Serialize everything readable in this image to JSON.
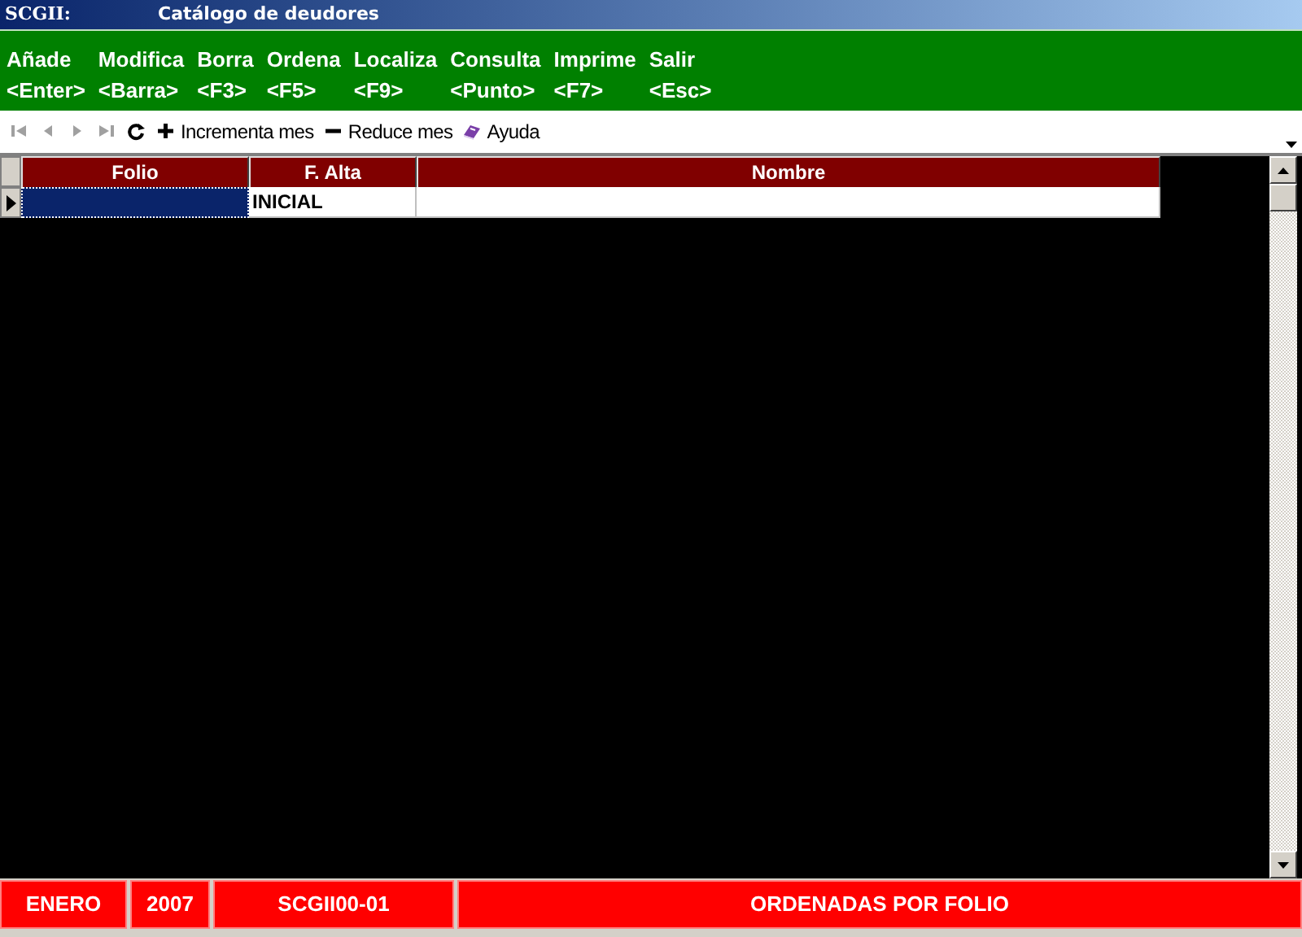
{
  "title_bar": {
    "app": "SCGII:",
    "title": "Catálogo de deudores"
  },
  "menu": [
    {
      "label": "Añade",
      "key": "<Enter>"
    },
    {
      "label": "Modifica",
      "key": "<Barra>"
    },
    {
      "label": "Borra",
      "key": "<F3>"
    },
    {
      "label": "Ordena",
      "key": "<F5>"
    },
    {
      "label": "Localiza",
      "key": "<F9>"
    },
    {
      "label": "Consulta",
      "key": "<Punto>"
    },
    {
      "label": "Imprime",
      "key": "<F7>"
    },
    {
      "label": "Salir",
      "key": "<Esc>"
    }
  ],
  "toolbar": [
    {
      "kind": "first",
      "disabled": true
    },
    {
      "kind": "prev",
      "disabled": true
    },
    {
      "kind": "next",
      "disabled": true
    },
    {
      "kind": "last",
      "disabled": true
    },
    {
      "kind": "refresh"
    },
    {
      "kind": "add",
      "label": "Incrementa mes"
    },
    {
      "kind": "remove",
      "label": "Reduce mes"
    },
    {
      "kind": "help",
      "label": "Ayuda"
    }
  ],
  "table": {
    "columns": [
      {
        "label": "Folio"
      },
      {
        "label": "F. Alta"
      },
      {
        "label": "Nombre"
      }
    ],
    "rows": [
      {
        "current": true,
        "cells": [
          {
            "selected": true
          },
          {
            "text": "INICIAL",
            "selected": false
          },
          {
            "selected": false
          }
        ]
      }
    ]
  },
  "status_bar": [
    "ENERO",
    "2007",
    "SCGII00-01",
    "ORDENADAS POR FOLIO"
  ]
}
